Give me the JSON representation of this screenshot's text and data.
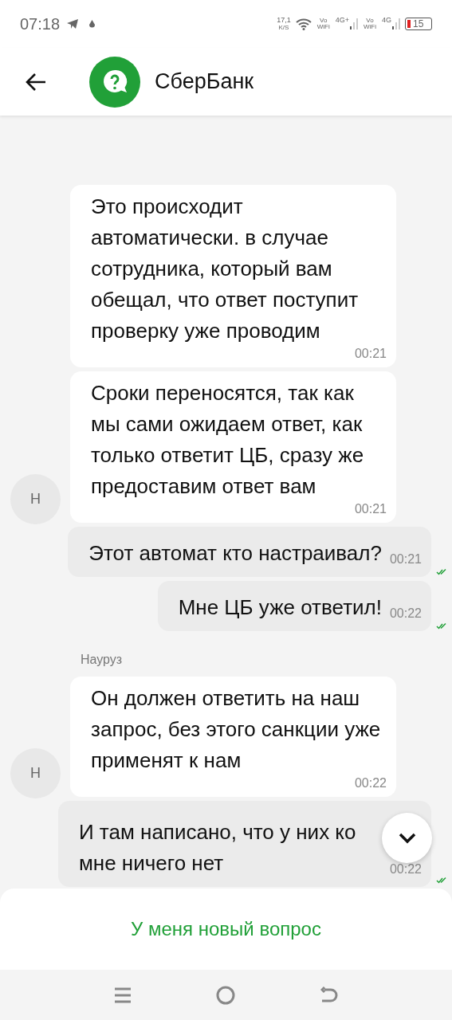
{
  "status_bar": {
    "time": "07:18",
    "speed": "17,1",
    "speed_unit": "K/S",
    "sim1_label": "Vo WiFi",
    "sim1_network": "4G+",
    "sim2_label": "Vo WiFi",
    "sim2_network": "4G",
    "battery": "15"
  },
  "header": {
    "title": "СберБанк"
  },
  "messages": [
    {
      "kind": "incoming",
      "text": "Это происходит автоматически. в случае сотрудника, который вам обещал, что ответ поступит проверку уже проводим",
      "time": "00:21"
    },
    {
      "kind": "incoming",
      "text": "Сроки переносятся, так как мы сами ожидаем ответ, как только ответит ЦБ, сразу же предоставим ответ вам",
      "time": "00:21",
      "avatar": "Н"
    },
    {
      "kind": "outgoing",
      "text": "Этот автомат кто настраивал?",
      "time": "00:21",
      "read": true
    },
    {
      "kind": "outgoing",
      "text": "Мне ЦБ уже ответил!",
      "time": "00:22",
      "read": true
    },
    {
      "kind": "sender",
      "text": "Науруз"
    },
    {
      "kind": "incoming",
      "text": "Он должен ответить на наш запрос, без этого санкции уже применят к нам",
      "time": "00:22",
      "avatar": "Н"
    },
    {
      "kind": "outgoing",
      "text": "И там написано, что у них ко мне ничего нет",
      "time": "00:22",
      "read": true
    }
  ],
  "bottom_action": {
    "label": "У меня новый вопрос"
  }
}
